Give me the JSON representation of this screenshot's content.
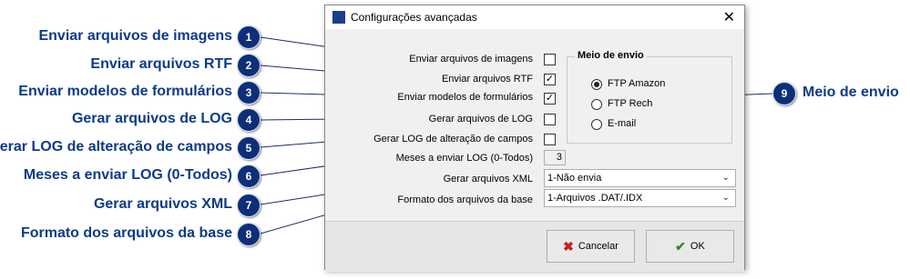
{
  "annotations": [
    {
      "n": "1",
      "text": "Enviar arquivos de imagens"
    },
    {
      "n": "2",
      "text": "Enviar arquivos RTF"
    },
    {
      "n": "3",
      "text": "Enviar modelos de formulários"
    },
    {
      "n": "4",
      "text": "Gerar arquivos de LOG"
    },
    {
      "n": "5",
      "text": "Gerar LOG de alteração de campos"
    },
    {
      "n": "6",
      "text": "Meses a enviar LOG (0-Todos)"
    },
    {
      "n": "7",
      "text": "Gerar arquivos XML"
    },
    {
      "n": "8",
      "text": "Formato dos arquivos da base"
    },
    {
      "n": "9",
      "text": "Meio de envio"
    }
  ],
  "dialog": {
    "title": "Configurações avançadas",
    "close_glyph": "✕",
    "fields": [
      {
        "label": "Enviar arquivos de imagens",
        "checked": false,
        "mark": ""
      },
      {
        "label": "Enviar arquivos RTF",
        "checked": true,
        "mark": "✓"
      },
      {
        "label": "Enviar modelos de formulários",
        "checked": true,
        "mark": "✓"
      },
      {
        "label": "Gerar arquivos de LOG",
        "checked": false,
        "mark": ""
      },
      {
        "label": "Gerar LOG de alteração de campos",
        "checked": false,
        "mark": ""
      }
    ],
    "months_label": "Meses a enviar LOG (0-Todos)",
    "months_value": "3",
    "xml_label": "Gerar arquivos XML",
    "xml_value": "1-Não envia",
    "format_label": "Formato dos arquivos da base",
    "format_value": "1-Arquivos .DAT/.IDX",
    "dropdown_glyph": "⌄",
    "send_group": {
      "legend": "Meio de envio",
      "options": [
        "FTP Amazon",
        "FTP Rech",
        "E-mail"
      ],
      "selected": "FTP Amazon"
    },
    "cancel_label": "Cancelar",
    "ok_label": "OK",
    "cancel_glyph": "✖",
    "ok_glyph": "✔"
  }
}
